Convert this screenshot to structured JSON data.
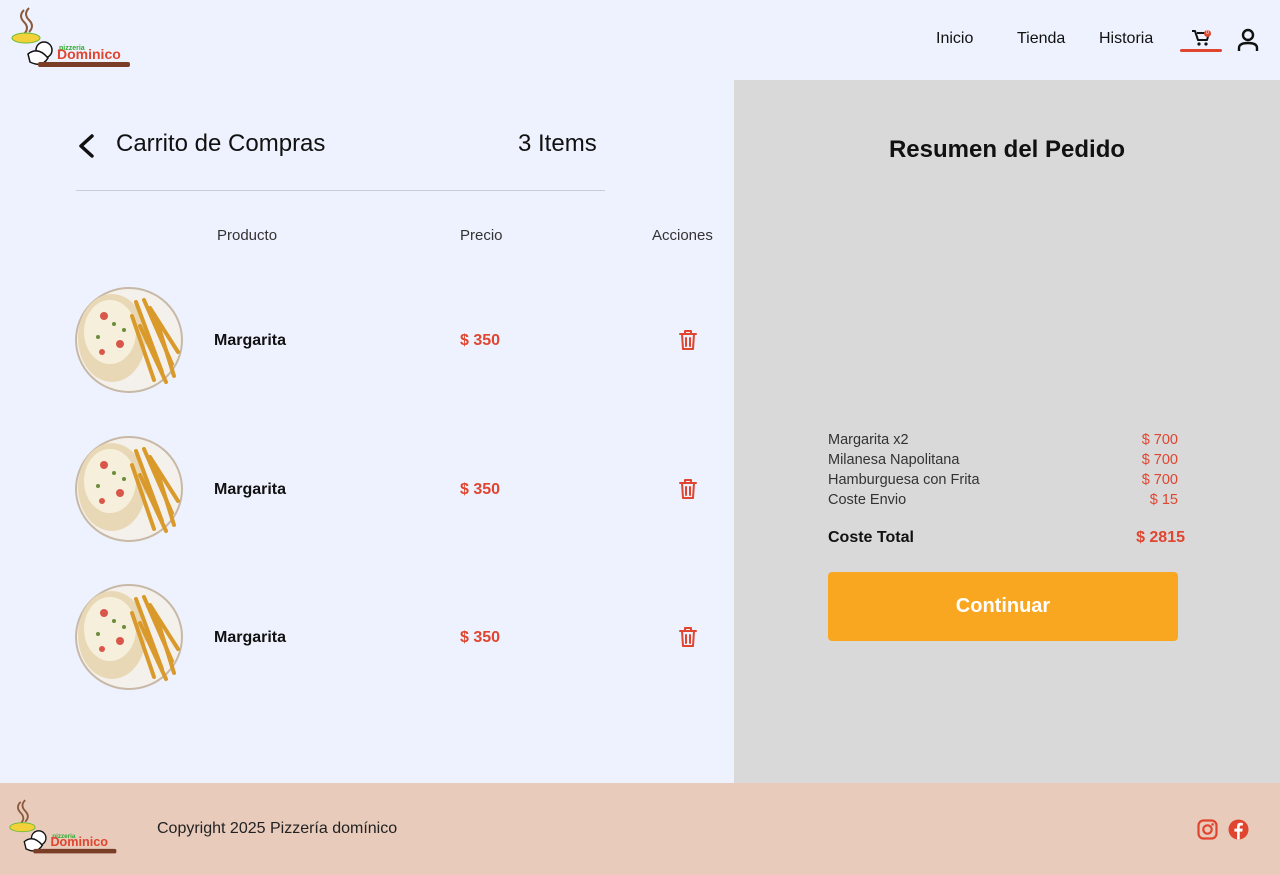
{
  "header": {
    "logo_text": "Dominico",
    "logo_subtext": "pizzeria",
    "nav": [
      "Inicio",
      "Tienda",
      "Historia"
    ],
    "cart_badge": "0"
  },
  "cart": {
    "title": "Carrito de Compras",
    "count_label": "3 Items",
    "columns": {
      "product": "Producto",
      "price": "Precio",
      "actions": "Acciones"
    },
    "items": [
      {
        "name": "Margarita",
        "price": "$ 350"
      },
      {
        "name": "Margarita",
        "price": "$ 350"
      },
      {
        "name": "Margarita",
        "price": "$ 350"
      }
    ]
  },
  "summary": {
    "title": "Resumen del Pedido",
    "lines": [
      {
        "label": "Margarita x2",
        "value": "$ 700"
      },
      {
        "label": "Milanesa Napolitana",
        "value": "$ 700"
      },
      {
        "label": "Hamburguesa con Frita",
        "value": "$ 700"
      },
      {
        "label": "Coste Envio",
        "value": "$ 15"
      }
    ],
    "total_label": "Coste Total",
    "total_value": "$ 2815",
    "continue_label": "Continuar"
  },
  "footer": {
    "copyright": "Copyright 2025 Pizzería domínico",
    "social": [
      "instagram-icon",
      "facebook-icon"
    ]
  },
  "colors": {
    "accent": "#E0452F",
    "button": "#F9A620",
    "background": "#EEF2FE",
    "summary_bg": "#D9D9D9",
    "footer_bg": "#E8CBBB"
  }
}
